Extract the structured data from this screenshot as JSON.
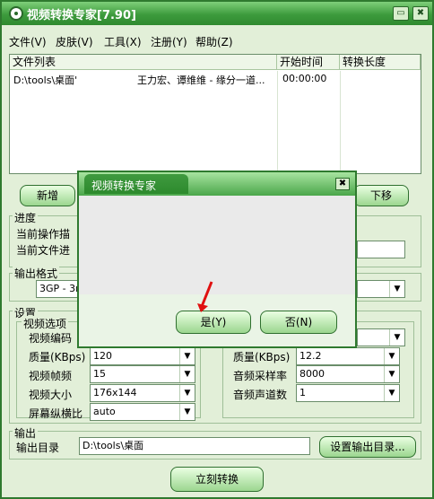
{
  "app": {
    "title": "视频转换专家[7.90]",
    "min": "▭",
    "close": "✖"
  },
  "menu": [
    "文件(V)",
    "皮肤(V)",
    "工具(X)",
    "注册(Y)",
    "帮助(Z)"
  ],
  "filelist": {
    "headers": [
      "文件列表",
      "开始时间",
      "转换长度"
    ],
    "row": {
      "path": "D:\\tools\\桌面'",
      "title": "王力宏、谭维维 - 缘分一道...",
      "start": "00:00:00",
      "length": ""
    }
  },
  "buttons": {
    "add": "新增",
    "down": "下移",
    "convert": "立刻转换",
    "set_output": "设置输出目录..."
  },
  "progress": {
    "label": "进度",
    "current_op": "当前操作描",
    "current_file": "当前文件进"
  },
  "output_format": {
    "label": "输出格式",
    "value": "3GP - 3r"
  },
  "settings": {
    "label": "设置",
    "video": {
      "label": "视频选项",
      "codec_label": "视频编码",
      "quality_label": "质量(KBps)",
      "quality": "120",
      "fps_label": "视频帧频",
      "fps": "15",
      "size_label": "视频大小",
      "size": "176x144",
      "aspect_label": "屏幕纵横比",
      "aspect": "auto"
    },
    "audio": {
      "quality_label": "质量(KBps)",
      "quality": "12.2",
      "samplerate_label": "音频采样率",
      "samplerate": "8000",
      "channels_label": "音频声道数",
      "channels": "1"
    }
  },
  "output": {
    "label": "输出",
    "dir_label": "输出目录",
    "dir": "D:\\tools\\桌面"
  },
  "dialog": {
    "title": "视频转换专家",
    "close": "✖",
    "yes": "是(Y)",
    "no": "否(N)"
  },
  "colors": {
    "accent": "#3d9b3d",
    "background": "#e2efd8",
    "arrow": "#e01010"
  }
}
